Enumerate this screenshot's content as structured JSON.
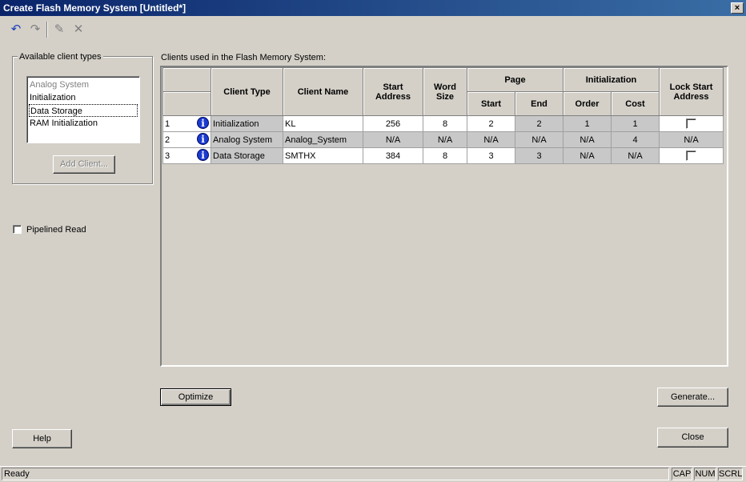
{
  "window": {
    "title": "Create Flash Memory System [Untitled*]",
    "close_glyph": "×"
  },
  "toolbar": {
    "undo_icon": "↶",
    "redo_icon": "↷",
    "edit_icon": "✎",
    "delete_icon": "✕"
  },
  "left_panel": {
    "group_label": "Available client types",
    "client_types": [
      "Analog System",
      "Initialization",
      "Data Storage",
      "RAM Initialization"
    ],
    "add_client_label": "Add Client...",
    "pipelined_read_label": "Pipelined Read",
    "help_label": "Help"
  },
  "grid": {
    "caption": "Clients used in the Flash Memory System:",
    "headers": {
      "client_type": "Client Type",
      "client_name": "Client Name",
      "start_address": "Start Address",
      "word_size": "Word Size",
      "page": "Page",
      "page_start": "Start",
      "page_end": "End",
      "initialization": "Initialization",
      "init_order": "Order",
      "init_cost": "Cost",
      "lock_start_address": "Lock Start Address"
    },
    "rows": [
      {
        "num": "1",
        "type": "Initialization",
        "name": "KL",
        "start_address": "256",
        "word_size": "8",
        "page_start": "2",
        "page_end": "2",
        "order": "1",
        "cost": "1",
        "lock": ""
      },
      {
        "num": "2",
        "type": "Analog System",
        "name": "Analog_System",
        "start_address": "N/A",
        "word_size": "N/A",
        "page_start": "N/A",
        "page_end": "N/A",
        "order": "N/A",
        "cost": "4",
        "lock": "N/A"
      },
      {
        "num": "3",
        "type": "Data Storage",
        "name": "SMTHX",
        "start_address": "384",
        "word_size": "8",
        "page_start": "3",
        "page_end": "3",
        "order": "N/A",
        "cost": "N/A",
        "lock": ""
      }
    ],
    "info_glyph": "i"
  },
  "buttons": {
    "optimize": "Optimize",
    "generate": "Generate...",
    "close": "Close"
  },
  "statusbar": {
    "text": "Ready",
    "cap": "CAP",
    "num": "NUM",
    "scrl": "SCRL"
  }
}
